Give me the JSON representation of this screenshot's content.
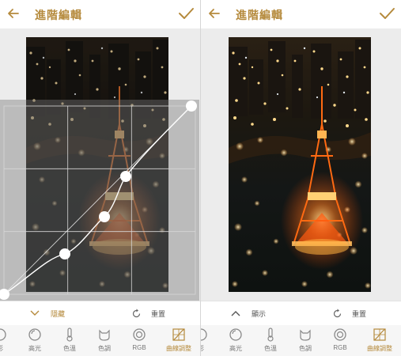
{
  "colors": {
    "accent": "#b58a3c",
    "overlay": "#767676"
  },
  "left_panel": {
    "title": "進階編輯",
    "toggle_label": "隱藏",
    "reset_label": "重置",
    "tools": [
      {
        "label": "影",
        "icon": "partial-tool-icon"
      },
      {
        "label": "高光",
        "icon": "highlight-icon"
      },
      {
        "label": "色溫",
        "icon": "thermometer-icon"
      },
      {
        "label": "色調",
        "icon": "tint-cat-icon"
      },
      {
        "label": "RGB",
        "icon": "rgb-icon"
      },
      {
        "label": "曲線調整",
        "icon": "curves-icon",
        "active": true
      }
    ]
  },
  "right_panel": {
    "title": "進階編輯",
    "toggle_label": "顯示",
    "reset_label": "重置",
    "tools": [
      {
        "label": "影",
        "icon": "partial-tool-icon"
      },
      {
        "label": "高光",
        "icon": "highlight-icon"
      },
      {
        "label": "色溫",
        "icon": "thermometer-icon"
      },
      {
        "label": "色調",
        "icon": "tint-cat-icon"
      },
      {
        "label": "RGB",
        "icon": "rgb-icon"
      },
      {
        "label": "曲線調整",
        "icon": "curves-icon",
        "active": true
      }
    ]
  }
}
